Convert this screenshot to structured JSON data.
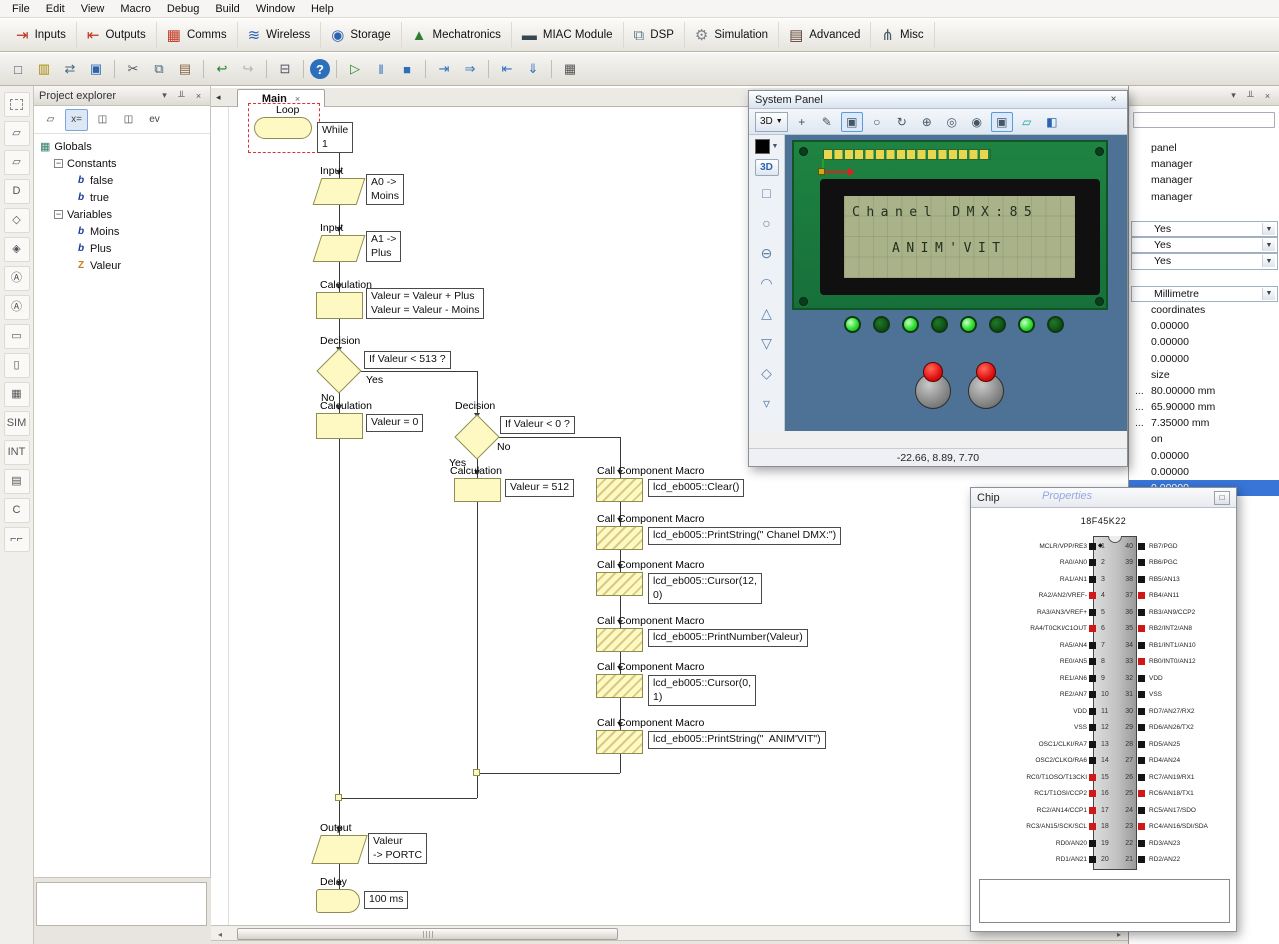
{
  "menu": {
    "items": [
      "File",
      "Edit",
      "View",
      "Macro",
      "Debug",
      "Build",
      "Window",
      "Help"
    ]
  },
  "component_toolbar": {
    "items": [
      {
        "label": "Inputs",
        "iname": "inputs-icon",
        "g": "⇥",
        "c": "#c0331e"
      },
      {
        "label": "Outputs",
        "iname": "outputs-icon",
        "g": "⇤",
        "c": "#c0331e"
      },
      {
        "label": "Comms",
        "iname": "comms-icon",
        "g": "▦",
        "c": "#c0331e"
      },
      {
        "label": "Wireless",
        "iname": "wireless-icon",
        "g": "≋",
        "c": "#2d64b0"
      },
      {
        "label": "Storage",
        "iname": "storage-icon",
        "g": "◉",
        "c": "#2d64b0"
      },
      {
        "label": "Mechatronics",
        "iname": "mechatronics-icon",
        "g": "▲",
        "c": "#2e7d32"
      },
      {
        "label": "MIAC Module",
        "iname": "miac-module-icon",
        "g": "▬",
        "c": "#37474f"
      },
      {
        "label": "DSP",
        "iname": "dsp-icon",
        "g": "⧉",
        "c": "#607d8b"
      },
      {
        "label": "Simulation",
        "iname": "simulation-icon",
        "g": "⚙",
        "c": "#78808a"
      },
      {
        "label": "Advanced",
        "iname": "advanced-icon",
        "g": "▤",
        "c": "#5d4037"
      },
      {
        "label": "Misc",
        "iname": "misc-icon",
        "g": "⋔",
        "c": "#455a64"
      }
    ]
  },
  "standard_toolbar": {
    "items": [
      {
        "n": "new-file-icon",
        "g": "□",
        "c": "#445566",
        "ia": "true"
      },
      {
        "n": "open-file-icon",
        "g": "▥",
        "c": "#aa8800",
        "ia": "true"
      },
      {
        "n": "import-icon",
        "g": "⇄",
        "c": "#446677",
        "ia": "true"
      },
      {
        "n": "save-icon",
        "g": "▣",
        "c": "#2d64b0",
        "ia": "true"
      },
      {
        "k": "sep",
        "ia": "false"
      },
      {
        "n": "cut-icon",
        "g": "✂",
        "c": "#555555",
        "ia": "true"
      },
      {
        "n": "copy-icon",
        "g": "⧉",
        "c": "#446677",
        "ia": "true"
      },
      {
        "n": "paste-icon",
        "g": "▤",
        "c": "#886644",
        "ia": "true"
      },
      {
        "k": "sep",
        "ia": "false"
      },
      {
        "n": "undo-icon",
        "g": "↩",
        "c": "#2a7d2a",
        "ia": "true"
      },
      {
        "n": "redo-icon",
        "g": "↪",
        "c": "#b5b2aa",
        "ia": "true"
      },
      {
        "k": "sep",
        "ia": "false"
      },
      {
        "n": "print-icon",
        "g": "⊟",
        "c": "#555566",
        "ia": "true"
      },
      {
        "k": "sep",
        "ia": "false"
      },
      {
        "n": "help-icon",
        "g": "?",
        "c": "#ffffff",
        "bg": "#2c6fbb",
        "k": "round",
        "ia": "true"
      },
      {
        "k": "sep",
        "ia": "false"
      },
      {
        "n": "run-icon",
        "g": "▷",
        "c": "#2a8a2a",
        "ia": "true"
      },
      {
        "n": "pause-icon",
        "g": "‖",
        "c": "#2c6fbb",
        "ia": "true"
      },
      {
        "n": "stop-icon",
        "g": "■",
        "c": "#2c6fbb",
        "ia": "true"
      },
      {
        "k": "sep",
        "ia": "false"
      },
      {
        "n": "step-into-icon",
        "g": "⇥",
        "c": "#2c6fbb",
        "ia": "true"
      },
      {
        "n": "step-over-icon",
        "g": "⇒",
        "c": "#2c6fbb",
        "ia": "true"
      },
      {
        "k": "sep",
        "ia": "false"
      },
      {
        "n": "step-out-icon",
        "g": "⇤",
        "c": "#2c6fbb",
        "ia": "true"
      },
      {
        "n": "run-to-cursor-icon",
        "g": "⇓",
        "c": "#2c6fbb",
        "ia": "true"
      },
      {
        "k": "sep",
        "ia": "false"
      },
      {
        "n": "program-chip-icon",
        "g": "▦",
        "c": "#555555",
        "ia": "true"
      }
    ]
  },
  "tool_strip": {
    "items": [
      {
        "n": "selection-tool-icon",
        "g": "",
        "k": "dash"
      },
      {
        "n": "input-tool-icon",
        "g": "▱"
      },
      {
        "n": "output-tool-icon",
        "g": "▱"
      },
      {
        "n": "delay-tool-icon",
        "g": "D"
      },
      {
        "n": "decision-tool-icon",
        "g": "◇"
      },
      {
        "n": "switch-tool-icon",
        "g": "◈"
      },
      {
        "n": "connection-a-icon",
        "g": "Ⓐ"
      },
      {
        "n": "connection-b-icon",
        "g": "Ⓐ"
      },
      {
        "n": "loop-tool-icon",
        "g": "▭"
      },
      {
        "n": "macro-tool-icon",
        "g": "▯"
      },
      {
        "n": "component-macro-tool-icon",
        "g": "▦"
      },
      {
        "n": "simulation-tool-icon",
        "g": "SIM"
      },
      {
        "n": "interrupt-tool-icon",
        "g": "INT"
      },
      {
        "n": "code-tool-icon",
        "g": "▤"
      },
      {
        "n": "c-code-tool-icon",
        "g": "C"
      },
      {
        "n": "comment-tool-icon",
        "g": "⌐⌐"
      }
    ]
  },
  "project_explorer": {
    "title": "Project explorer",
    "tools": [
      {
        "n": "pe-component-icon",
        "g": "▱"
      },
      {
        "n": "pe-variables-icon",
        "g": "x=",
        "k": "sel"
      },
      {
        "n": "pe-macros-icon",
        "g": "◫"
      },
      {
        "n": "pe-functions-icon",
        "g": "◫"
      },
      {
        "n": "pe-events-icon",
        "g": "ev"
      }
    ],
    "root": "Globals",
    "groups": [
      {
        "label": "Constants",
        "items": [
          {
            "g": "b",
            "label": "false"
          },
          {
            "g": "b",
            "label": "true"
          }
        ]
      },
      {
        "label": "Variables",
        "items": [
          {
            "g": "b",
            "label": "Moins"
          },
          {
            "g": "b",
            "label": "Plus"
          },
          {
            "g": "Z",
            "label": "Valeur"
          }
        ]
      }
    ]
  },
  "canvas": {
    "tab": "Main",
    "close": "×",
    "scroll_left": "◂",
    "scroll_right": "▸",
    "tab_scroll": "◂"
  },
  "flow": {
    "loop_label": "Loop",
    "loop_text": "While\n1",
    "input_label": "Input",
    "in1_text": "A0 ->\nMoins",
    "in2_text": "A1 ->\nPlus",
    "calc_label": "Calculation",
    "calc1_text": "Valeur = Valeur + Plus\nValeur = Valeur - Moins",
    "calc2_text": "Valeur = 0",
    "calc3_text": "Valeur = 512",
    "dec_label": "Decision",
    "dec1_text": "If Valeur < 513 ?",
    "dec2_text": "If Valeur < 0 ?",
    "yes": "Yes",
    "no": "No",
    "macro_label": "Call Component Macro",
    "m1": "lcd_eb005::Clear()",
    "m2": "lcd_eb005::PrintString(\" Chanel DMX:\")",
    "m3": "lcd_eb005::Cursor(12,\n0)",
    "m4": "lcd_eb005::PrintNumber(Valeur)",
    "m5": "lcd_eb005::Cursor(0,\n1)",
    "m6": "lcd_eb005::PrintString(\"  ANIM'VIT\")",
    "out_label": "Output",
    "out_text": "Valeur\n-> PORTC",
    "delay_label": "Delay",
    "delay_text": "100 ms"
  },
  "system_panel": {
    "title": "System Panel",
    "mode": "3D",
    "status": "-22.66, 8.89, 7.70",
    "toolbar": [
      {
        "n": "move-icon",
        "g": "+"
      },
      {
        "n": "pencil-icon",
        "g": "✎"
      },
      {
        "n": "select-box-icon",
        "g": "▣",
        "k": "sel"
      },
      {
        "n": "rotate-icon",
        "g": "○"
      },
      {
        "n": "orbit-icon",
        "g": "↻"
      },
      {
        "n": "pan-icon",
        "g": "⊕"
      },
      {
        "n": "zoom-icon",
        "g": "◎"
      },
      {
        "n": "camera-icon",
        "g": "◉"
      },
      {
        "n": "box-mode-icon",
        "g": "▣",
        "k": "sel"
      },
      {
        "n": "plane-icon",
        "g": "▱",
        "c": "#18a0a0"
      },
      {
        "n": "cube-icon",
        "g": "◧",
        "c": "#2d64b0"
      }
    ],
    "shapes": [
      {
        "n": "cube-shape-icon",
        "g": "□"
      },
      {
        "n": "sphere-shape-icon",
        "g": "○"
      },
      {
        "n": "ellipse-shape-icon",
        "g": "⊖"
      },
      {
        "n": "disc-shape-icon",
        "g": "◠"
      },
      {
        "n": "cone-shape-icon",
        "g": "△"
      },
      {
        "n": "cone-down-shape-icon",
        "g": "▽"
      },
      {
        "n": "compass-shape-icon",
        "g": "◇"
      },
      {
        "n": "pyramid-shape-icon",
        "g": "▿"
      }
    ],
    "lcd": {
      "line1": "Chanel DMX:85",
      "line2": "ANIM'VIT"
    },
    "leds": [
      "on",
      "off",
      "on",
      "off",
      "on",
      "off",
      "on",
      "off"
    ]
  },
  "chip": {
    "title": "Chip",
    "part": "18F45K22",
    "left_pins": [
      {
        "name": "MCLR/VPP/RE3",
        "n": 1,
        "c": "k"
      },
      {
        "name": "RA0/AN0",
        "n": 2,
        "c": "k"
      },
      {
        "name": "RA1/AN1",
        "n": 3,
        "c": "k"
      },
      {
        "name": "RA2/AN2/VREF-",
        "n": 4,
        "c": "r"
      },
      {
        "name": "RA3/AN3/VREF+",
        "n": 5,
        "c": "k"
      },
      {
        "name": "RA4/T0CKI/C1OUT",
        "n": 6,
        "c": "r"
      },
      {
        "name": "RA5/AN4",
        "n": 7,
        "c": "k"
      },
      {
        "name": "RE0/AN5",
        "n": 8,
        "c": "k"
      },
      {
        "name": "RE1/AN6",
        "n": 9,
        "c": "k"
      },
      {
        "name": "RE2/AN7",
        "n": 10,
        "c": "k"
      },
      {
        "name": "VDD",
        "n": 11,
        "c": "k"
      },
      {
        "name": "VSS",
        "n": 12,
        "c": "k"
      },
      {
        "name": "OSC1/CLKI/RA7",
        "n": 13,
        "c": "k"
      },
      {
        "name": "OSC2/CLKO/RA6",
        "n": 14,
        "c": "k"
      },
      {
        "name": "RC0/T1OSO/T13CKI",
        "n": 15,
        "c": "r"
      },
      {
        "name": "RC1/T1OSI/CCP2",
        "n": 16,
        "c": "r"
      },
      {
        "name": "RC2/AN14/CCP1",
        "n": 17,
        "c": "r"
      },
      {
        "name": "RC3/AN15/SCK/SCL",
        "n": 18,
        "c": "r"
      },
      {
        "name": "RD0/AN20",
        "n": 19,
        "c": "k"
      },
      {
        "name": "RD1/AN21",
        "n": 20,
        "c": "k"
      }
    ],
    "right_pins": [
      {
        "name": "RB7/PGD",
        "n": 40,
        "c": "k"
      },
      {
        "name": "RB6/PGC",
        "n": 39,
        "c": "k"
      },
      {
        "name": "RB5/AN13",
        "n": 38,
        "c": "k"
      },
      {
        "name": "RB4/AN11",
        "n": 37,
        "c": "r"
      },
      {
        "name": "RB3/AN9/CCP2",
        "n": 36,
        "c": "k"
      },
      {
        "name": "RB2/INT2/AN8",
        "n": 35,
        "c": "r"
      },
      {
        "name": "RB1/INT1/AN10",
        "n": 34,
        "c": "k"
      },
      {
        "name": "RB0/INT0/AN12",
        "n": 33,
        "c": "r"
      },
      {
        "name": "VDD",
        "n": 32,
        "c": "k"
      },
      {
        "name": "VSS",
        "n": 31,
        "c": "k"
      },
      {
        "name": "RD7/AN27/RX2",
        "n": 30,
        "c": "k"
      },
      {
        "name": "RD6/AN26/TX2",
        "n": 29,
        "c": "k"
      },
      {
        "name": "RD5/AN25",
        "n": 28,
        "c": "k"
      },
      {
        "name": "RD4/AN24",
        "n": 27,
        "c": "k"
      },
      {
        "name": "RC7/AN19/RX1",
        "n": 26,
        "c": "k"
      },
      {
        "name": "RC6/AN18/TX1",
        "n": 25,
        "c": "r"
      },
      {
        "name": "RC5/AN17/SDO",
        "n": 24,
        "c": "k"
      },
      {
        "name": "RC4/AN16/SDI/SDA",
        "n": 23,
        "c": "r"
      },
      {
        "name": "RD3/AN23",
        "n": 22,
        "c": "k"
      },
      {
        "name": "RD2/AN22",
        "n": 21,
        "c": "k"
      }
    ]
  },
  "props": {
    "rows": [
      {
        "f": "",
        "v": "panel",
        "k": "text",
        "ia": "true"
      },
      {
        "f": "",
        "v": "manager",
        "k": "text",
        "ia": "true"
      },
      {
        "f": "",
        "v": "manager",
        "k": "text",
        "ia": "true"
      },
      {
        "f": "",
        "v": "manager",
        "k": "text",
        "ia": "true"
      },
      {
        "f": "",
        "v": "",
        "k": "blank",
        "ia": "false"
      },
      {
        "f": "",
        "v": "Yes",
        "k": "combo",
        "ia": "true"
      },
      {
        "f": "",
        "v": "Yes",
        "k": "combo",
        "ia": "true"
      },
      {
        "f": "",
        "v": "Yes",
        "k": "combo",
        "ia": "true"
      },
      {
        "f": "",
        "v": "",
        "k": "blank",
        "ia": "false"
      },
      {
        "f": "",
        "v": "Millimetre",
        "k": "combo",
        "ia": "true"
      },
      {
        "f": "",
        "v": "coordinates",
        "k": "section",
        "ia": "true"
      },
      {
        "f": "",
        "v": "0.00000",
        "k": "text",
        "ia": "true"
      },
      {
        "f": "",
        "v": "0.00000",
        "k": "text",
        "ia": "true"
      },
      {
        "f": "",
        "v": "0.00000",
        "k": "text",
        "ia": "true"
      },
      {
        "f": "",
        "v": "size",
        "k": "section",
        "ia": "true"
      },
      {
        "f": "...",
        "v": "80.00000 mm",
        "k": "text",
        "ia": "true"
      },
      {
        "f": "...",
        "v": "65.90000 mm",
        "k": "text",
        "ia": "true"
      },
      {
        "f": "...",
        "v": "7.35000 mm",
        "k": "text",
        "ia": "true"
      },
      {
        "f": "",
        "v": "on",
        "k": "section",
        "ia": "true"
      },
      {
        "f": "",
        "v": "0.00000",
        "k": "text",
        "ia": "true"
      },
      {
        "f": "",
        "v": "0.00000",
        "k": "text",
        "ia": "true"
      },
      {
        "f": "",
        "v": "0.00000",
        "k": "sel",
        "ia": "true"
      }
    ]
  },
  "ghost": {
    "title": "Properties"
  }
}
